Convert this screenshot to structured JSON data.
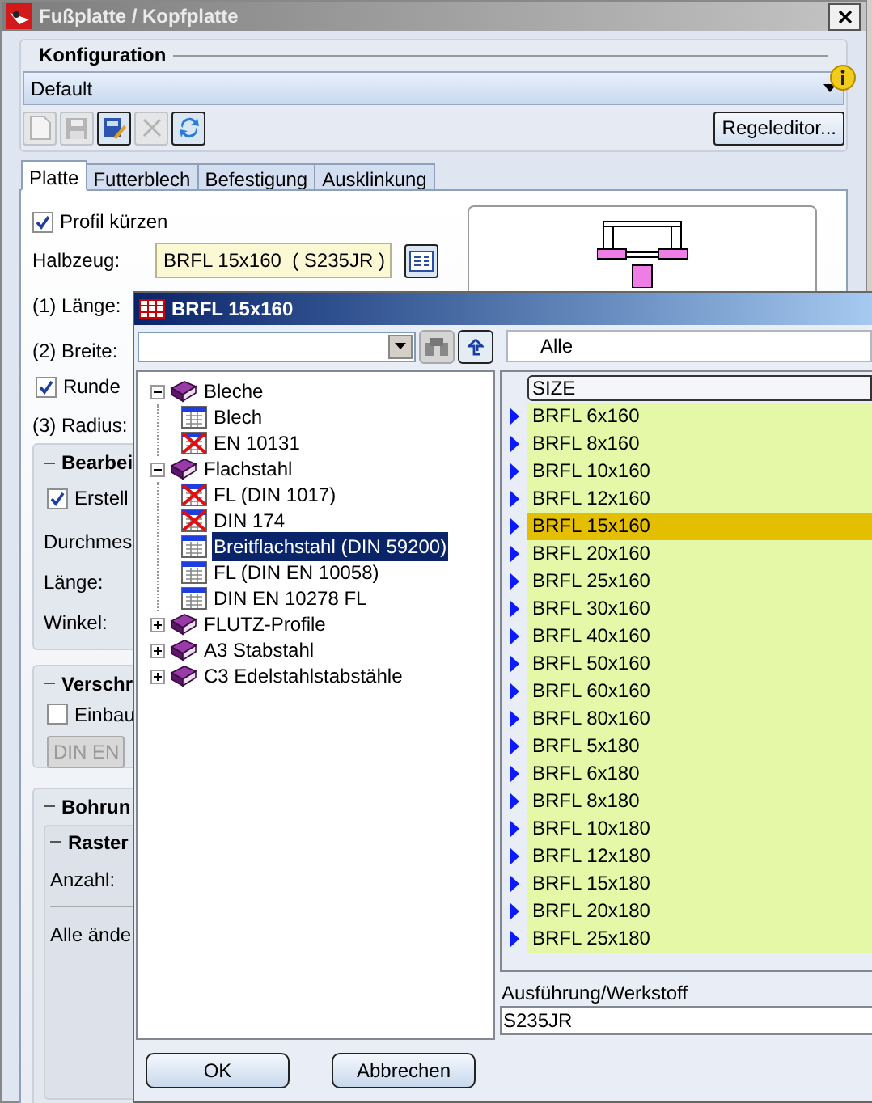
{
  "window": {
    "title": "Fußplatte / Kopfplatte"
  },
  "konfiguration": {
    "title": "Konfiguration",
    "value": "Default",
    "rule_button": "Regeleditor...",
    "toolbar": [
      {
        "kind": "new",
        "disabled": true
      },
      {
        "kind": "save",
        "disabled": true
      },
      {
        "kind": "edit",
        "disabled": false
      },
      {
        "kind": "delete",
        "disabled": true
      },
      {
        "kind": "refresh",
        "disabled": false
      }
    ]
  },
  "tabs": [
    {
      "label": "Platte",
      "selected": true
    },
    {
      "label": "Futterblech",
      "selected": false
    },
    {
      "label": "Befestigung",
      "selected": false
    },
    {
      "label": "Ausklinkung",
      "selected": false
    }
  ],
  "platte": {
    "profil_kuerzen": {
      "label": "Profil kürzen",
      "checked": true
    },
    "halbzeug": {
      "label": "Halbzeug:",
      "value": "BRFL 15x160  ( S235JR )"
    },
    "laenge": "(1) Länge:",
    "breite": "(2) Breite:",
    "runden": {
      "label": "Runde",
      "checked": true
    },
    "radius": "(3) Radius:"
  },
  "bearbeitung": {
    "title": "Bearbei",
    "checkbox": {
      "label": "Erstell",
      "checked": true
    },
    "labels": [
      "Durchmes",
      "Länge:",
      "Winkel:"
    ]
  },
  "verschraubung": {
    "title": "Verschr",
    "checkbox": {
      "label": "Einbau",
      "checked": false
    },
    "button": "DIN EN"
  },
  "bohrung": {
    "title": "Bohrun",
    "raster": {
      "title": "Raster",
      "label": "Anzahl:",
      "note": "Alle ände"
    }
  },
  "selector": {
    "title": "BRFL 15x160",
    "filter": "Alle",
    "tree": [
      {
        "label": "Bleche",
        "kind": "folder",
        "expanded": true,
        "selected": false,
        "children": [
          {
            "label": "Blech",
            "kind": "table",
            "crossed": false,
            "selected": false
          },
          {
            "label": "EN 10131",
            "kind": "table",
            "crossed": true,
            "selected": false
          }
        ]
      },
      {
        "label": "Flachstahl",
        "kind": "folder",
        "expanded": true,
        "selected": false,
        "children": [
          {
            "label": "FL (DIN 1017)",
            "kind": "table",
            "crossed": true,
            "selected": false
          },
          {
            "label": "DIN 174",
            "kind": "table",
            "crossed": true,
            "selected": false
          },
          {
            "label": "Breitflachstahl (DIN 59200)",
            "kind": "table",
            "crossed": false,
            "selected": true
          },
          {
            "label": "FL (DIN EN 10058)",
            "kind": "table",
            "crossed": false,
            "selected": false
          },
          {
            "label": "DIN EN 10278 FL",
            "kind": "table",
            "crossed": false,
            "selected": false
          }
        ]
      },
      {
        "label": "FLUTZ-Profile",
        "kind": "folder",
        "expanded": false,
        "selected": false
      },
      {
        "label": "A3 Stabstahl",
        "kind": "folder",
        "expanded": false,
        "selected": false
      },
      {
        "label": "C3 Edelstahlstabstähle",
        "kind": "folder",
        "expanded": false,
        "selected": false
      }
    ],
    "column": "SIZE",
    "rows": [
      {
        "label": "BRFL 6x160",
        "selected": false
      },
      {
        "label": "BRFL 8x160",
        "selected": false
      },
      {
        "label": "BRFL 10x160",
        "selected": false
      },
      {
        "label": "BRFL 12x160",
        "selected": false
      },
      {
        "label": "BRFL 15x160",
        "selected": true
      },
      {
        "label": "BRFL 20x160",
        "selected": false
      },
      {
        "label": "BRFL 25x160",
        "selected": false
      },
      {
        "label": "BRFL 30x160",
        "selected": false
      },
      {
        "label": "BRFL 40x160",
        "selected": false
      },
      {
        "label": "BRFL 50x160",
        "selected": false
      },
      {
        "label": "BRFL 60x160",
        "selected": false
      },
      {
        "label": "BRFL 80x160",
        "selected": false
      },
      {
        "label": "BRFL 5x180",
        "selected": false
      },
      {
        "label": "BRFL 6x180",
        "selected": false
      },
      {
        "label": "BRFL 8x180",
        "selected": false
      },
      {
        "label": "BRFL 10x180",
        "selected": false
      },
      {
        "label": "BRFL 12x180",
        "selected": false
      },
      {
        "label": "BRFL 15x180",
        "selected": false
      },
      {
        "label": "BRFL 20x180",
        "selected": false
      },
      {
        "label": "BRFL 25x180",
        "selected": false
      }
    ],
    "material_label": "Ausführung/Werkstoff",
    "material": "S235JR",
    "buttons": [
      "OK",
      "Abbrechen"
    ]
  }
}
